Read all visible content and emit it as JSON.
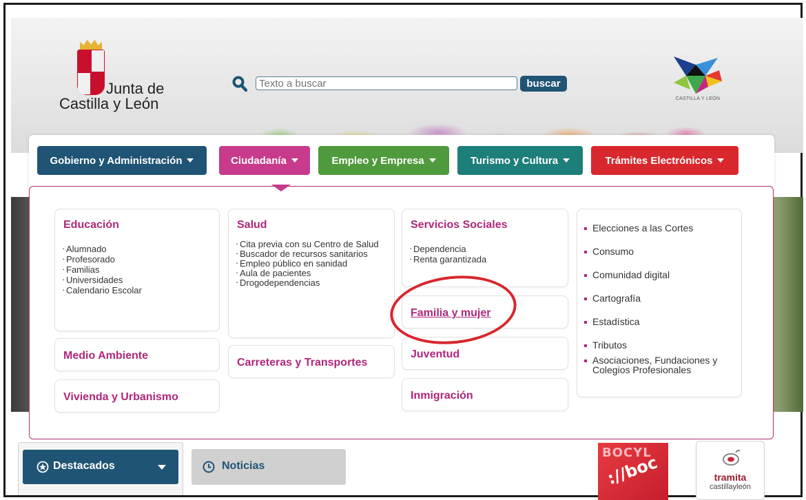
{
  "header": {
    "logo_line1": "Junta de",
    "logo_line2": "Castilla y León",
    "search_placeholder": "Texto a buscar",
    "search_button": "buscar",
    "brand_caption": "CASTILLA Y LEÓN"
  },
  "nav": [
    {
      "label": "Gobierno y Administración",
      "color": "#1f5475"
    },
    {
      "label": "Ciudadanía",
      "color": "#c83a8b"
    },
    {
      "label": "Empleo y Empresa",
      "color": "#4f9a3c"
    },
    {
      "label": "Turismo y Cultura",
      "color": "#1d7f79"
    },
    {
      "label": "Trámites Electrónicos",
      "color": "#d8282d"
    }
  ],
  "menu": {
    "educacion": {
      "title": "Educación",
      "items": [
        "Alumnado",
        "Profesorado",
        "Familias",
        "Universidades",
        "Calendario Escolar"
      ]
    },
    "salud": {
      "title": "Salud",
      "items": [
        "Cita previa con su Centro de Salud",
        "Buscador de recursos sanitarios",
        "Empleo público en sanidad",
        "Aula de pacientes",
        "Drogodependencias"
      ]
    },
    "servicios": {
      "title": "Servicios Sociales",
      "items": [
        "Dependencia",
        "Renta garantizada"
      ]
    },
    "medio_ambiente": "Medio Ambiente",
    "vivienda": "Vivienda y Urbanismo",
    "carreteras": "Carreteras y Transportes",
    "familia": "Familia y mujer",
    "juventud": "Juventud",
    "inmigracion": "Inmigración",
    "side_links": [
      "Elecciones a las Cortes",
      "Consumo",
      "Comunidad digital",
      "Cartografía",
      "Estadística",
      "Tributos",
      "Asociaciones, Fundaciones y Colegios Profesionales"
    ]
  },
  "tabs": {
    "destacados": "Destacados",
    "noticias": "Noticias"
  },
  "banners": {
    "bocyl": "BOCYL",
    "bocyl_url": "://boc",
    "tramita_title": "tramita",
    "tramita_sub": "castillayleón"
  }
}
